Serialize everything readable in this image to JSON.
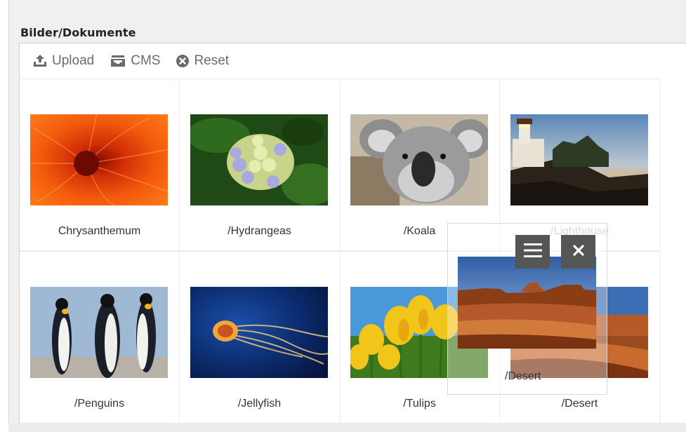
{
  "section": {
    "title": "Bilder/Dokumente"
  },
  "toolbar": {
    "upload_label": "Upload",
    "cms_label": "CMS",
    "reset_label": "Reset",
    "icons": {
      "upload": "upload-icon",
      "cms": "inbox-icon",
      "reset": "reset-icon"
    }
  },
  "images": [
    {
      "name": "Chrysanthemum",
      "thumb": "chrysanthemum"
    },
    {
      "name": "/Hydrangeas",
      "thumb": "hydrangeas"
    },
    {
      "name": "/Koala",
      "thumb": "koala"
    },
    {
      "name": "/Lighthouse",
      "thumb": "lighthouse",
      "state": "faded"
    },
    {
      "name": "/Penguins",
      "thumb": "penguins"
    },
    {
      "name": "/Jellyfish",
      "thumb": "jellyfish"
    },
    {
      "name": "/Tulips",
      "thumb": "tulips"
    },
    {
      "name": "/Desert",
      "thumb": "desert"
    }
  ],
  "drag": {
    "label": "/Desert",
    "thumb": "desert",
    "menu_icon": "hamburger-icon",
    "close_icon": "close-icon"
  },
  "colors": {
    "control_bg": "#555555",
    "toolbar_text": "#6b6b6b"
  }
}
